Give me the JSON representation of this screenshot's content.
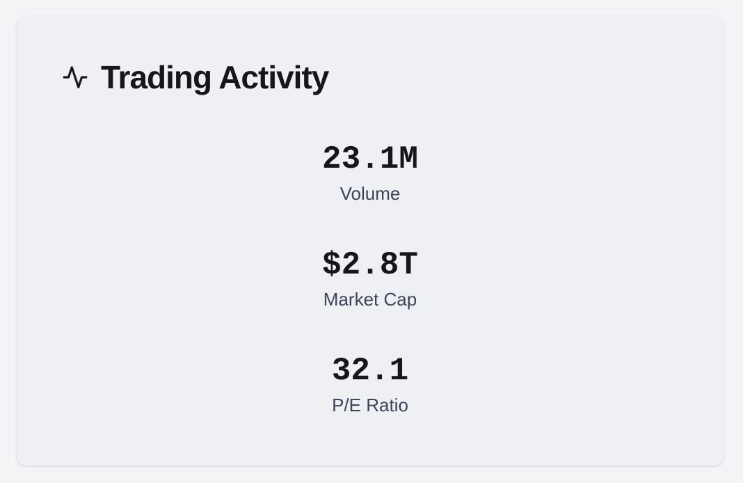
{
  "card": {
    "title": "Trading Activity",
    "icon": "activity-icon"
  },
  "metrics": [
    {
      "value": "23.1M",
      "label": "Volume"
    },
    {
      "value": "$2.8T",
      "label": "Market Cap"
    },
    {
      "value": "32.1",
      "label": "P/E Ratio"
    }
  ],
  "colors": {
    "page_background": "#f4f4f6",
    "card_background": "#eef0f4",
    "title_text": "#15171c",
    "label_text": "#3c4558"
  }
}
